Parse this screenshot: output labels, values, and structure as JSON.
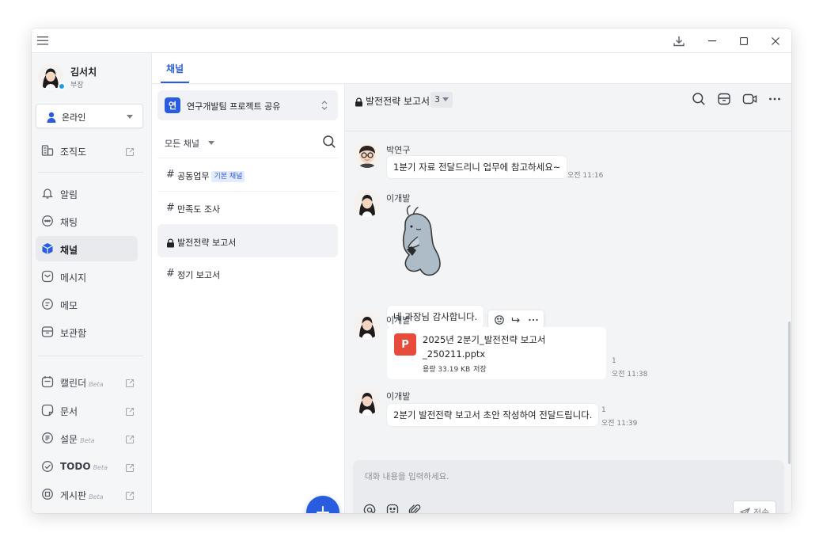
{
  "profile": {
    "name": "김서치",
    "role": "부장"
  },
  "status": {
    "label": "온라인"
  },
  "nav": {
    "org": "조직도",
    "alerts": "알림",
    "chat": "채팅",
    "channel": "채널",
    "message": "메시지",
    "memo": "메모",
    "storage": "보관함",
    "calendar": "캘린더",
    "docs": "문서",
    "survey": "설문",
    "todo": "TODO",
    "board": "게시판",
    "beta": "Beta"
  },
  "tabs": {
    "channel": "채널"
  },
  "team": {
    "badge": "연",
    "name": "연구개발팀 프로젝트 공유"
  },
  "filter": {
    "label": "모든 채널"
  },
  "channels": [
    {
      "name": "공동업무",
      "tag": "기본 채널"
    },
    {
      "name": "만족도 조사"
    },
    {
      "name": "발전전략 보고서"
    },
    {
      "name": "정기 보고서"
    }
  ],
  "chat": {
    "title": "발전전략 보고서",
    "member_count": "3",
    "messages": [
      {
        "sender": "박연구",
        "text": "1분기 자료 전달드리니 업무에 참고하세요~",
        "time": "오전 11:16"
      },
      {
        "sender": "이개발",
        "sticker": "whale-sticker"
      },
      {
        "text": "네 과장님 감사합니다."
      },
      {
        "sender": "이개발",
        "file_name": "2025년 2분기_발전전략 보고서 _250211.pptx",
        "file_icon": "P",
        "file_size": "용량 33.19 KB",
        "file_save": "저장",
        "unread": "1",
        "time": "오전 11:38"
      },
      {
        "sender": "이개발",
        "text": "2분기 발전전략 보고서 초안 작성하여 전달드립니다.",
        "unread": "1",
        "time": "오전 11:39"
      }
    ]
  },
  "composer": {
    "placeholder": "대화 내용을 입력하세요.",
    "send_label": "전송"
  },
  "colors": {
    "accent": "#2a5ce0",
    "pdf": "#e84b3c",
    "online": "#1e9be9"
  }
}
